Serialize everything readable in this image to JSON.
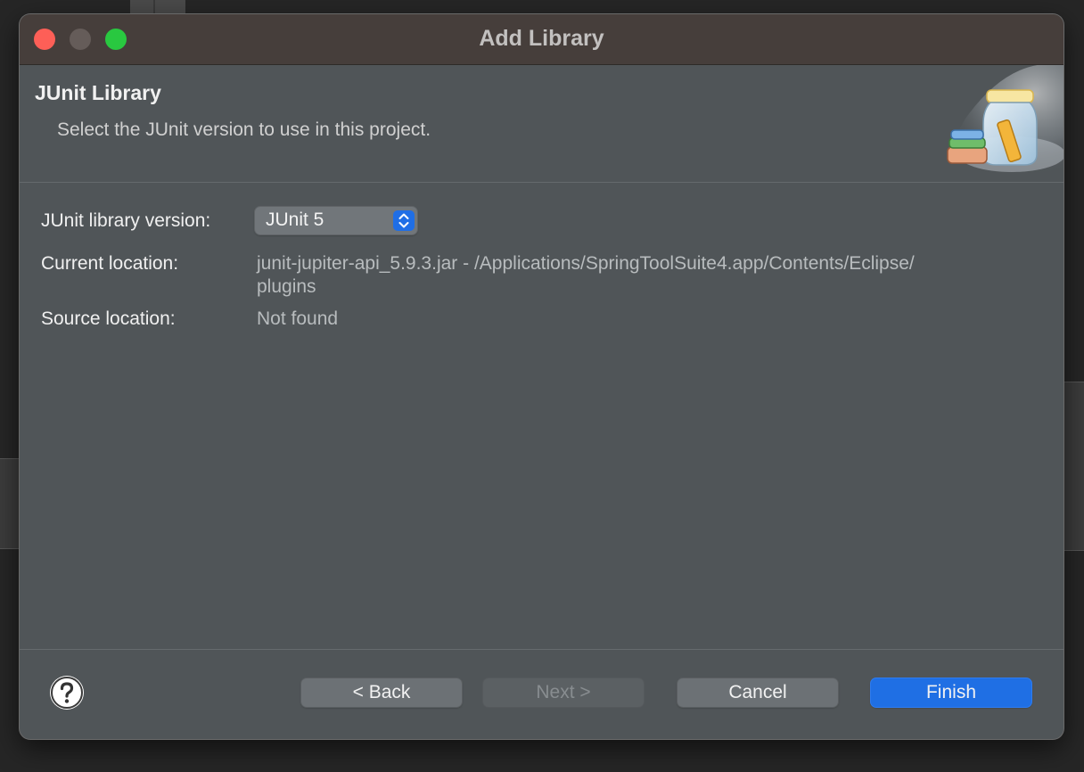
{
  "window": {
    "title": "Add Library"
  },
  "header": {
    "title": "JUnit Library",
    "description": "Select the JUnit version to use in this project."
  },
  "form": {
    "version_label": "JUnit library version:",
    "version_value": "JUnit 5",
    "current_location_label": "Current location:",
    "current_location_line1": "junit-jupiter-api_5.9.3.jar - /Applications/SpringToolSuite4.app/Contents/Eclipse/",
    "current_location_line2": "plugins",
    "source_location_label": "Source location:",
    "source_location_value": "Not found"
  },
  "buttons": {
    "back": "< Back",
    "next": "Next >",
    "cancel": "Cancel",
    "finish": "Finish"
  },
  "icons": {
    "help": "help-icon",
    "wizard": "library-jar-icon",
    "select_arrows": "chevron-updown-icon"
  },
  "colors": {
    "accent": "#1f6fe4",
    "close": "#fe5f57",
    "maximize": "#29c840"
  }
}
